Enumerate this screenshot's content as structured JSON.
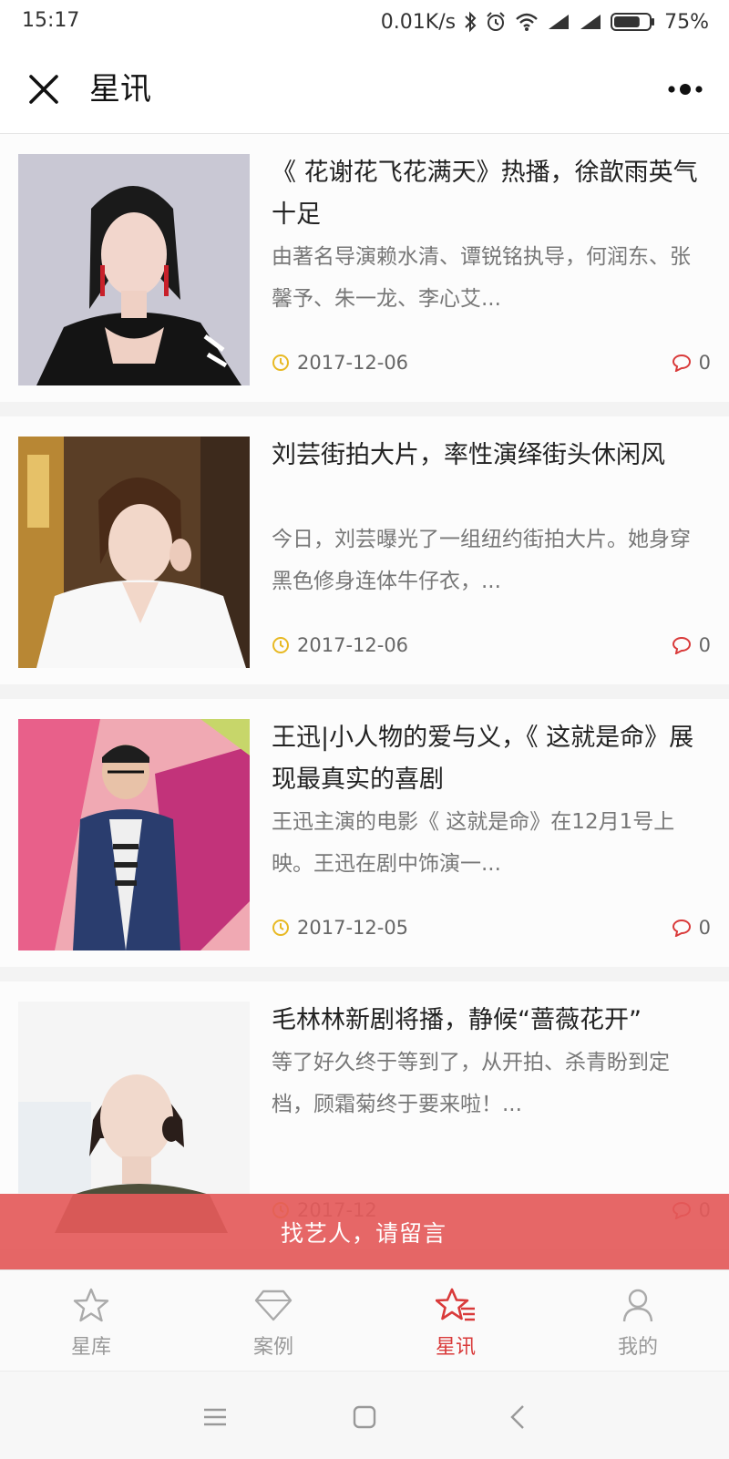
{
  "status_bar": {
    "time": "15:17",
    "network_speed": "0.01K/s",
    "battery_percent": "75%",
    "battery_level": 0.75,
    "icons": [
      "bluetooth-icon",
      "alarm-icon",
      "wifi-icon",
      "signal-icon",
      "signal-icon",
      "battery-icon"
    ]
  },
  "header": {
    "title": "星讯",
    "close_icon": "close-icon",
    "more_icon": "more-icon"
  },
  "news": [
    {
      "title": "《 花谢花飞花满天》热播，徐歆雨英气十足",
      "description": "由著名导演赖水清、谭锐铭执导，何润东、张馨予、朱一龙、李心艾...",
      "date": "2017-12-06",
      "comments": "0"
    },
    {
      "title": "刘芸街拍大片，率性演绎街头休闲风",
      "description": "今日，刘芸曝光了一组纽约街拍大片。她身穿黑色修身连体牛仔衣，...",
      "date": "2017-12-06",
      "comments": "0"
    },
    {
      "title": "王迅|小人物的爱与义，《 这就是命》展现最真实的喜剧",
      "description": "王迅主演的电影《 这就是命》在12月1号上映。王迅在剧中饰演一...",
      "date": "2017-12-05",
      "comments": "0"
    },
    {
      "title": "毛林林新剧将播，静候“蔷薇花开”",
      "description": "等了好久终于等到了，从开拍、杀青盼到定档，顾霜菊终于要来啦！...",
      "date": "2017-12",
      "comments": "0"
    }
  ],
  "banner": {
    "text": "找艺人，请留言"
  },
  "tabs": [
    {
      "label": "星库",
      "icon": "star-icon",
      "active": false
    },
    {
      "label": "案例",
      "icon": "diamond-icon",
      "active": false
    },
    {
      "label": "星讯",
      "icon": "star-news-icon",
      "active": true
    },
    {
      "label": "我的",
      "icon": "person-icon",
      "active": false
    }
  ],
  "colors": {
    "accent": "#d93a3a",
    "banner": "#e45a5a",
    "clock_icon": "#e8b923",
    "inactive_tab": "#999999"
  }
}
